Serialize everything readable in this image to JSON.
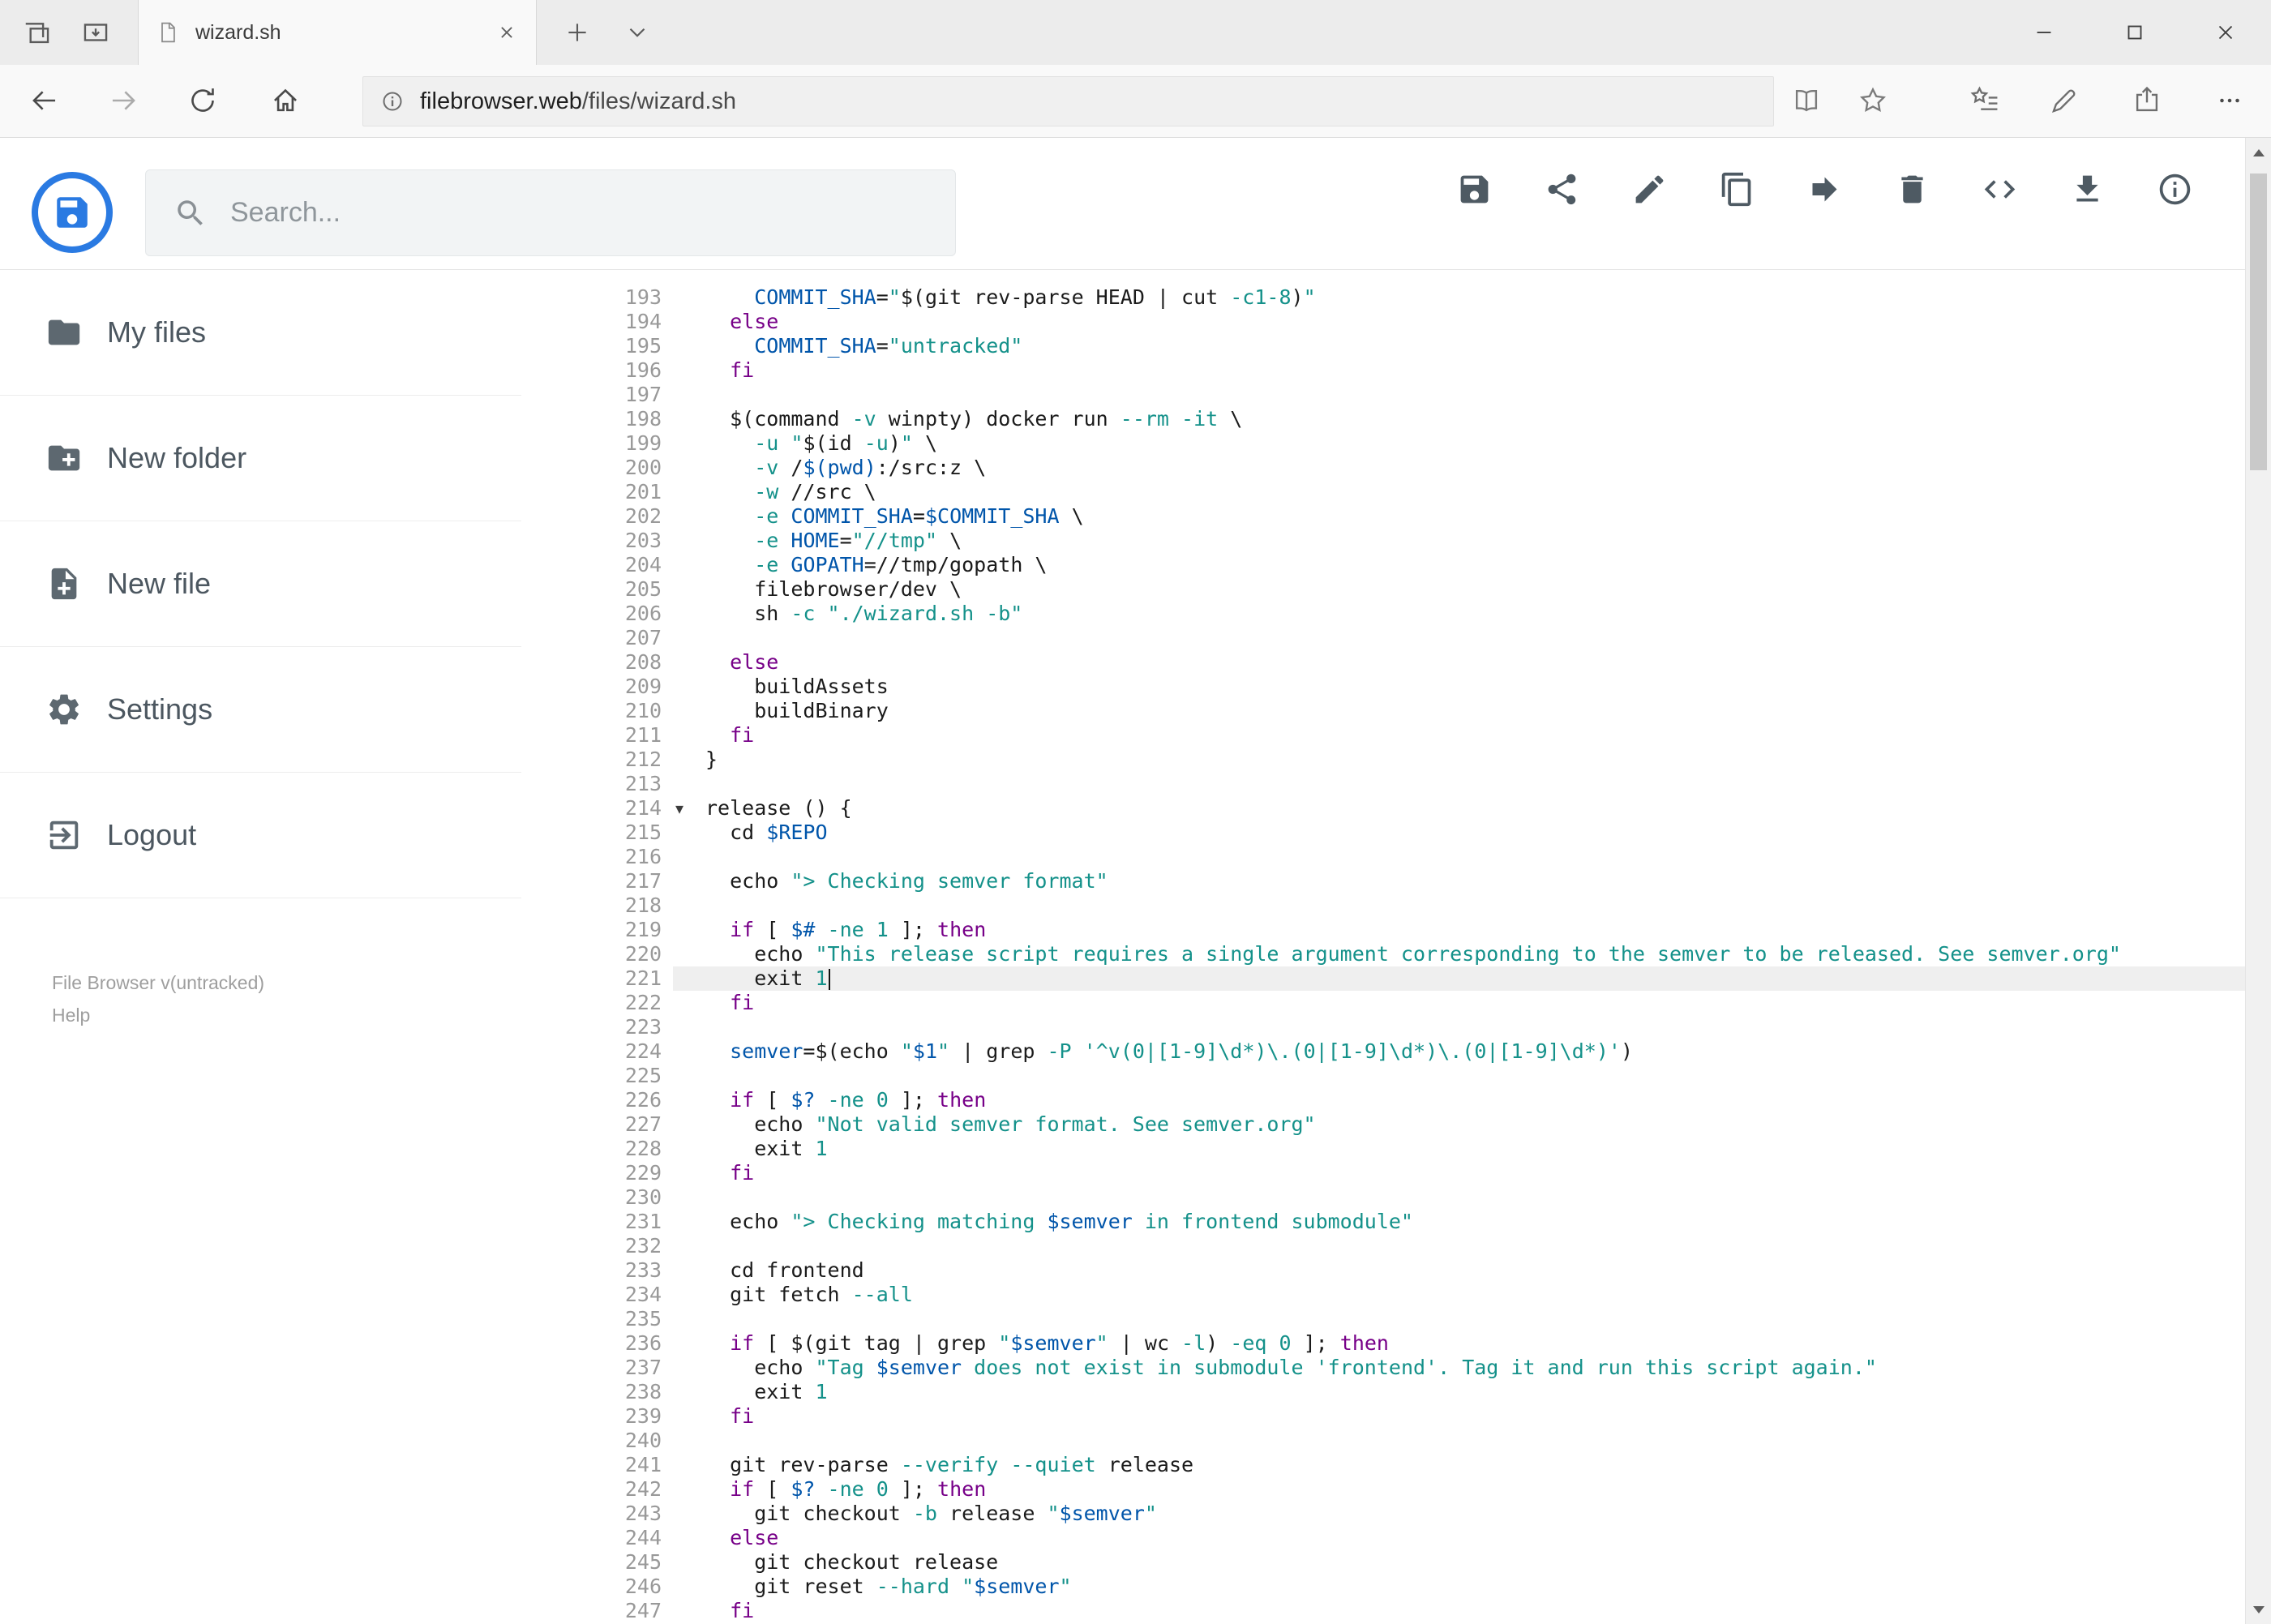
{
  "theme": {
    "accent": "#2a7ae2"
  },
  "browser": {
    "tab_title": "wizard.sh",
    "url_domain": "filebrowser.web",
    "url_path": "/files/wizard.sh",
    "icons": {
      "tabbar_left": [
        "set-aside-tabs-icon",
        "tab-preview-icon"
      ],
      "tab": [
        "page-icon",
        "close-tab-icon"
      ],
      "tabbar_right": [
        "new-tab-icon",
        "tabs-chevron-icon"
      ],
      "window_controls": [
        "minimize-icon",
        "maximize-icon",
        "close-icon"
      ],
      "navbar": [
        "back-icon",
        "forward-icon",
        "refresh-icon",
        "home-icon",
        "info-icon",
        "reading-view-icon",
        "favorite-star-icon",
        "hub-icon",
        "annotate-pen-icon",
        "share-page-icon",
        "more-icon"
      ]
    }
  },
  "header": {
    "search_placeholder": "Search...",
    "actions": [
      "save-icon",
      "share-icon",
      "edit-icon",
      "copy-icon",
      "move-icon",
      "delete-icon",
      "code-icon",
      "download-icon",
      "info-icon"
    ]
  },
  "sidebar": {
    "items": [
      {
        "id": "my-files",
        "label": "My files",
        "icon": "folder-icon"
      },
      {
        "id": "new-folder",
        "label": "New folder",
        "icon": "new-folder-icon"
      },
      {
        "id": "new-file",
        "label": "New file",
        "icon": "new-file-icon"
      },
      {
        "id": "settings",
        "label": "Settings",
        "icon": "gear-icon"
      },
      {
        "id": "logout",
        "label": "Logout",
        "icon": "logout-icon"
      }
    ],
    "footer": {
      "version": "File Browser v(untracked)",
      "help": "Help"
    }
  },
  "editor": {
    "active_line": 221,
    "cursor_line": 221,
    "fold_marker_line": 214,
    "fold_marker": "▾",
    "syntax_colors": {
      "keyword": "#770088",
      "string": "#14918a",
      "variable": "#0055aa",
      "option": "#14918a",
      "number": "#14918a"
    },
    "lines": [
      {
        "n": 193,
        "t": [
          [
            "p",
            "    "
          ],
          [
            "v",
            "COMMIT_SHA"
          ],
          [
            "p",
            "="
          ],
          [
            "s",
            "\""
          ],
          [
            "p",
            "$(git rev-parse HEAD | cut "
          ],
          [
            "a",
            "-c1-8"
          ],
          [
            "p",
            ")"
          ],
          [
            "s",
            "\""
          ]
        ]
      },
      {
        "n": 194,
        "t": [
          [
            "p",
            "  "
          ],
          [
            "k",
            "else"
          ]
        ]
      },
      {
        "n": 195,
        "t": [
          [
            "p",
            "    "
          ],
          [
            "v",
            "COMMIT_SHA"
          ],
          [
            "p",
            "="
          ],
          [
            "s",
            "\"untracked\""
          ]
        ]
      },
      {
        "n": 196,
        "t": [
          [
            "p",
            "  "
          ],
          [
            "k",
            "fi"
          ]
        ]
      },
      {
        "n": 197,
        "t": []
      },
      {
        "n": 198,
        "t": [
          [
            "p",
            "  $(command "
          ],
          [
            "a",
            "-v"
          ],
          [
            "p",
            " winpty) docker run "
          ],
          [
            "a",
            "--rm"
          ],
          [
            "p",
            " "
          ],
          [
            "a",
            "-it"
          ],
          [
            "p",
            " \\"
          ]
        ]
      },
      {
        "n": 199,
        "t": [
          [
            "p",
            "    "
          ],
          [
            "a",
            "-u"
          ],
          [
            "p",
            " "
          ],
          [
            "s",
            "\""
          ],
          [
            "p",
            "$(id "
          ],
          [
            "a",
            "-u"
          ],
          [
            "p",
            ")"
          ],
          [
            "s",
            "\""
          ],
          [
            "p",
            " \\"
          ]
        ]
      },
      {
        "n": 200,
        "t": [
          [
            "p",
            "    "
          ],
          [
            "a",
            "-v"
          ],
          [
            "p",
            " /"
          ],
          [
            "v",
            "$(pwd)"
          ],
          [
            "p",
            ":/src:z \\"
          ]
        ]
      },
      {
        "n": 201,
        "t": [
          [
            "p",
            "    "
          ],
          [
            "a",
            "-w"
          ],
          [
            "p",
            " //src \\"
          ]
        ]
      },
      {
        "n": 202,
        "t": [
          [
            "p",
            "    "
          ],
          [
            "a",
            "-e"
          ],
          [
            "p",
            " "
          ],
          [
            "v",
            "COMMIT_SHA"
          ],
          [
            "p",
            "="
          ],
          [
            "v",
            "$COMMIT_SHA"
          ],
          [
            "p",
            " \\"
          ]
        ]
      },
      {
        "n": 203,
        "t": [
          [
            "p",
            "    "
          ],
          [
            "a",
            "-e"
          ],
          [
            "p",
            " "
          ],
          [
            "v",
            "HOME"
          ],
          [
            "p",
            "="
          ],
          [
            "s",
            "\"//tmp\""
          ],
          [
            "p",
            " \\"
          ]
        ]
      },
      {
        "n": 204,
        "t": [
          [
            "p",
            "    "
          ],
          [
            "a",
            "-e"
          ],
          [
            "p",
            " "
          ],
          [
            "v",
            "GOPATH"
          ],
          [
            "p",
            "=//tmp/gopath \\"
          ]
        ]
      },
      {
        "n": 205,
        "t": [
          [
            "p",
            "    filebrowser/dev \\"
          ]
        ]
      },
      {
        "n": 206,
        "t": [
          [
            "p",
            "    sh "
          ],
          [
            "a",
            "-c"
          ],
          [
            "p",
            " "
          ],
          [
            "s",
            "\"./wizard.sh -b\""
          ]
        ]
      },
      {
        "n": 207,
        "t": []
      },
      {
        "n": 208,
        "t": [
          [
            "p",
            "  "
          ],
          [
            "k",
            "else"
          ]
        ]
      },
      {
        "n": 209,
        "t": [
          [
            "p",
            "    buildAssets"
          ]
        ]
      },
      {
        "n": 210,
        "t": [
          [
            "p",
            "    buildBinary"
          ]
        ]
      },
      {
        "n": 211,
        "t": [
          [
            "p",
            "  "
          ],
          [
            "k",
            "fi"
          ]
        ]
      },
      {
        "n": 212,
        "t": [
          [
            "p",
            "}"
          ]
        ]
      },
      {
        "n": 213,
        "t": []
      },
      {
        "n": 214,
        "t": [
          [
            "p",
            "release () {"
          ]
        ]
      },
      {
        "n": 215,
        "t": [
          [
            "p",
            "  cd "
          ],
          [
            "v",
            "$REPO"
          ]
        ]
      },
      {
        "n": 216,
        "t": []
      },
      {
        "n": 217,
        "t": [
          [
            "p",
            "  echo "
          ],
          [
            "s",
            "\"> Checking semver format\""
          ]
        ]
      },
      {
        "n": 218,
        "t": []
      },
      {
        "n": 219,
        "t": [
          [
            "p",
            "  "
          ],
          [
            "k",
            "if"
          ],
          [
            "p",
            " [ "
          ],
          [
            "v",
            "$#"
          ],
          [
            "p",
            " "
          ],
          [
            "a",
            "-ne"
          ],
          [
            "p",
            " "
          ],
          [
            "n",
            "1"
          ],
          [
            "p",
            " ]; "
          ],
          [
            "k",
            "then"
          ]
        ]
      },
      {
        "n": 220,
        "t": [
          [
            "p",
            "    echo "
          ],
          [
            "s",
            "\"This release script requires a single argument corresponding to the semver to be released. See semver.org\""
          ]
        ]
      },
      {
        "n": 221,
        "t": [
          [
            "p",
            "    exit "
          ],
          [
            "n",
            "1"
          ]
        ]
      },
      {
        "n": 222,
        "t": [
          [
            "p",
            "  "
          ],
          [
            "k",
            "fi"
          ]
        ]
      },
      {
        "n": 223,
        "t": []
      },
      {
        "n": 224,
        "t": [
          [
            "p",
            "  "
          ],
          [
            "v",
            "semver"
          ],
          [
            "p",
            "=$(echo "
          ],
          [
            "s",
            "\""
          ],
          [
            "v",
            "$1"
          ],
          [
            "s",
            "\""
          ],
          [
            "p",
            " | grep "
          ],
          [
            "a",
            "-P"
          ],
          [
            "p",
            " "
          ],
          [
            "s",
            "'^v(0|[1-9]\\d*)\\.(0|[1-9]\\d*)\\.(0|[1-9]\\d*)'"
          ],
          [
            "p",
            ")"
          ]
        ]
      },
      {
        "n": 225,
        "t": []
      },
      {
        "n": 226,
        "t": [
          [
            "p",
            "  "
          ],
          [
            "k",
            "if"
          ],
          [
            "p",
            " [ "
          ],
          [
            "v",
            "$?"
          ],
          [
            "p",
            " "
          ],
          [
            "a",
            "-ne"
          ],
          [
            "p",
            " "
          ],
          [
            "n",
            "0"
          ],
          [
            "p",
            " ]; "
          ],
          [
            "k",
            "then"
          ]
        ]
      },
      {
        "n": 227,
        "t": [
          [
            "p",
            "    echo "
          ],
          [
            "s",
            "\"Not valid semver format. See semver.org\""
          ]
        ]
      },
      {
        "n": 228,
        "t": [
          [
            "p",
            "    exit "
          ],
          [
            "n",
            "1"
          ]
        ]
      },
      {
        "n": 229,
        "t": [
          [
            "p",
            "  "
          ],
          [
            "k",
            "fi"
          ]
        ]
      },
      {
        "n": 230,
        "t": []
      },
      {
        "n": 231,
        "t": [
          [
            "p",
            "  echo "
          ],
          [
            "s",
            "\"> Checking matching "
          ],
          [
            "v",
            "$semver"
          ],
          [
            "s",
            " in front­end submodule\""
          ]
        ]
      },
      {
        "n": 232,
        "t": []
      },
      {
        "n": 233,
        "t": [
          [
            "p",
            "  cd frontend"
          ]
        ]
      },
      {
        "n": 234,
        "t": [
          [
            "p",
            "  git fetch "
          ],
          [
            "a",
            "--all"
          ]
        ]
      },
      {
        "n": 235,
        "t": []
      },
      {
        "n": 236,
        "t": [
          [
            "p",
            "  "
          ],
          [
            "k",
            "if"
          ],
          [
            "p",
            " [ $(git tag | grep "
          ],
          [
            "s",
            "\""
          ],
          [
            "v",
            "$semver"
          ],
          [
            "s",
            "\""
          ],
          [
            "p",
            " | wc "
          ],
          [
            "a",
            "-l"
          ],
          [
            "p",
            ") "
          ],
          [
            "a",
            "-eq"
          ],
          [
            "p",
            " "
          ],
          [
            "n",
            "0"
          ],
          [
            "p",
            " ]; "
          ],
          [
            "k",
            "then"
          ]
        ]
      },
      {
        "n": 237,
        "t": [
          [
            "p",
            "    echo "
          ],
          [
            "s",
            "\"Tag "
          ],
          [
            "v",
            "$semver"
          ],
          [
            "s",
            " does not exist in submodule 'frontend'. Tag it and run this script again.\""
          ]
        ]
      },
      {
        "n": 238,
        "t": [
          [
            "p",
            "    exit "
          ],
          [
            "n",
            "1"
          ]
        ]
      },
      {
        "n": 239,
        "t": [
          [
            "p",
            "  "
          ],
          [
            "k",
            "fi"
          ]
        ]
      },
      {
        "n": 240,
        "t": []
      },
      {
        "n": 241,
        "t": [
          [
            "p",
            "  git rev-parse "
          ],
          [
            "a",
            "--verify"
          ],
          [
            "p",
            " "
          ],
          [
            "a",
            "--quiet"
          ],
          [
            "p",
            " release"
          ]
        ]
      },
      {
        "n": 242,
        "t": [
          [
            "p",
            "  "
          ],
          [
            "k",
            "if"
          ],
          [
            "p",
            " [ "
          ],
          [
            "v",
            "$?"
          ],
          [
            "p",
            " "
          ],
          [
            "a",
            "-ne"
          ],
          [
            "p",
            " "
          ],
          [
            "n",
            "0"
          ],
          [
            "p",
            " ]; "
          ],
          [
            "k",
            "then"
          ]
        ]
      },
      {
        "n": 243,
        "t": [
          [
            "p",
            "    git checkout "
          ],
          [
            "a",
            "-b"
          ],
          [
            "p",
            " release "
          ],
          [
            "s",
            "\""
          ],
          [
            "v",
            "$semver"
          ],
          [
            "s",
            "\""
          ]
        ]
      },
      {
        "n": 244,
        "t": [
          [
            "p",
            "  "
          ],
          [
            "k",
            "else"
          ]
        ]
      },
      {
        "n": 245,
        "t": [
          [
            "p",
            "    git checkout release"
          ]
        ]
      },
      {
        "n": 246,
        "t": [
          [
            "p",
            "    git reset "
          ],
          [
            "a",
            "--hard"
          ],
          [
            "p",
            " "
          ],
          [
            "s",
            "\""
          ],
          [
            "v",
            "$semver"
          ],
          [
            "s",
            "\""
          ]
        ]
      },
      {
        "n": 247,
        "t": [
          [
            "p",
            "  "
          ],
          [
            "k",
            "fi"
          ]
        ]
      }
    ]
  }
}
